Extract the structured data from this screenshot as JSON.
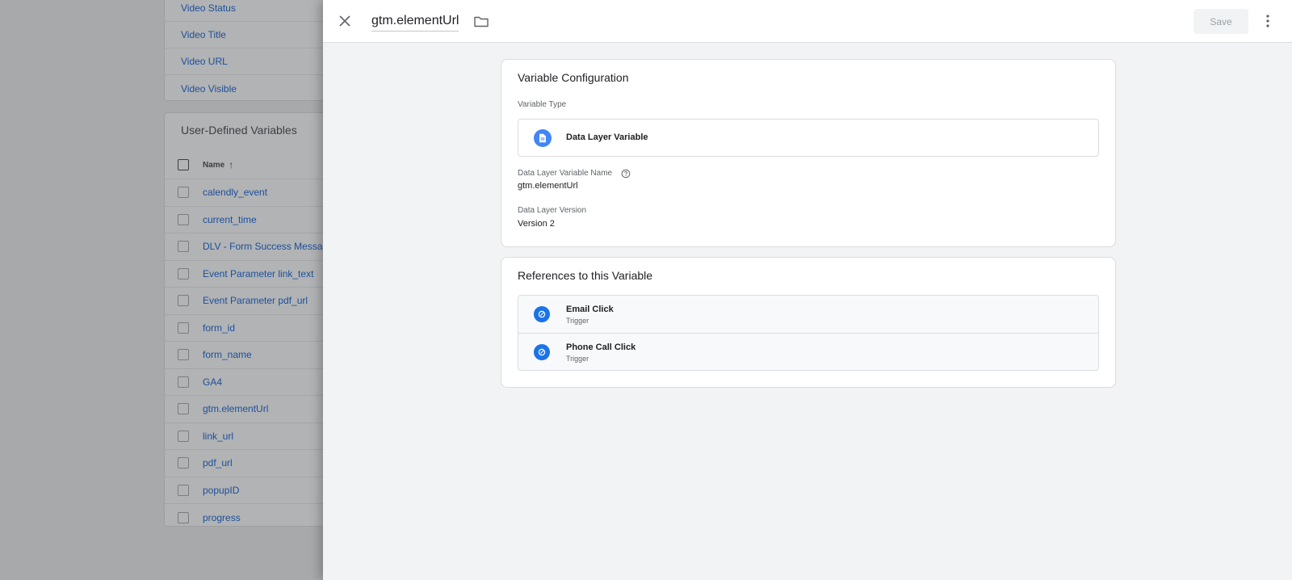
{
  "background": {
    "builtin_rows": [
      "Video Status",
      "Video Title",
      "Video URL",
      "Video Visible"
    ],
    "udv_title": "User-Defined Variables",
    "column_name": "Name",
    "sort_icon": "arrow-up-icon",
    "udv_rows": [
      "calendly_event",
      "current_time",
      "DLV - Form Success Message",
      "Event Parameter link_text",
      "Event Parameter pdf_url",
      "form_id",
      "form_name",
      "GA4",
      "gtm.elementUrl",
      "link_url",
      "pdf_url",
      "popupID",
      "progress"
    ]
  },
  "header": {
    "title": "gtm.elementUrl",
    "close_icon": "close-icon",
    "folder_icon": "folder-icon",
    "save_label": "Save",
    "more_icon": "more-vert-icon"
  },
  "config": {
    "title": "Variable Configuration",
    "type_label": "Variable Type",
    "type_name": "Data Layer Variable",
    "type_icon": "document-icon",
    "name_label": "Data Layer Variable Name",
    "name_value": "gtm.elementUrl",
    "version_label": "Data Layer Version",
    "version_value": "Version 2"
  },
  "references": {
    "title": "References to this Variable",
    "items": [
      {
        "name": "Email Click",
        "kind": "Trigger",
        "icon": "trigger-icon"
      },
      {
        "name": "Phone Call Click",
        "kind": "Trigger",
        "icon": "trigger-icon"
      }
    ]
  },
  "colors": {
    "accent": "#1a73e8",
    "type_icon_bg": "#4285f4",
    "link_dimmed": "#1d4f9a"
  }
}
